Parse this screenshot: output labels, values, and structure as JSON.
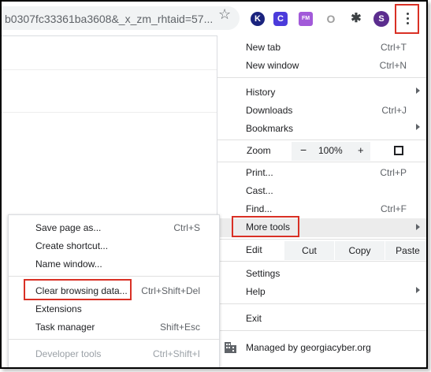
{
  "toolbar": {
    "url_text": "b0307fc33361ba3608&_x_zm_rhtaid=57...",
    "star_icon": "☆",
    "extensions": [
      {
        "name": "k-extension-icon",
        "letter": "K",
        "color": "#1a237e"
      },
      {
        "name": "c-extension-icon",
        "letter": "C",
        "color": "#4b3bdb"
      },
      {
        "name": "puzzle-purple-extension-icon",
        "letter": "FM",
        "color": "#a25ad9"
      },
      {
        "name": "office-extension-icon",
        "letter": "O",
        "color": "#9e9e9e"
      },
      {
        "name": "extensions-puzzle-icon",
        "letter": "✱",
        "color": "#3c4043"
      },
      {
        "name": "profile-avatar",
        "letter": "S",
        "color": "#5b2d8e"
      }
    ]
  },
  "menu": {
    "new_tab": {
      "label": "New tab",
      "shortcut": "Ctrl+T"
    },
    "new_window": {
      "label": "New window",
      "shortcut": "Ctrl+N"
    },
    "history": {
      "label": "History"
    },
    "downloads": {
      "label": "Downloads",
      "shortcut": "Ctrl+J"
    },
    "bookmarks": {
      "label": "Bookmarks"
    },
    "zoom": {
      "label": "Zoom",
      "minus": "−",
      "value": "100%",
      "plus": "+"
    },
    "print": {
      "label": "Print...",
      "shortcut": "Ctrl+P"
    },
    "cast": {
      "label": "Cast..."
    },
    "find": {
      "label": "Find...",
      "shortcut": "Ctrl+F"
    },
    "more_tools": {
      "label": "More tools"
    },
    "edit": {
      "label": "Edit",
      "cut": "Cut",
      "copy": "Copy",
      "paste": "Paste"
    },
    "settings": {
      "label": "Settings"
    },
    "help": {
      "label": "Help"
    },
    "exit": {
      "label": "Exit"
    },
    "managed": {
      "label": "Managed by georgiacyber.org"
    }
  },
  "submenu": {
    "save_page": {
      "label": "Save page as...",
      "shortcut": "Ctrl+S"
    },
    "create_shortcut": {
      "label": "Create shortcut..."
    },
    "name_window": {
      "label": "Name window..."
    },
    "clear_data": {
      "label": "Clear browsing data...",
      "shortcut": "Ctrl+Shift+Del"
    },
    "extensions": {
      "label": "Extensions"
    },
    "task_manager": {
      "label": "Task manager",
      "shortcut": "Shift+Esc"
    },
    "developer_tools": {
      "label": "Developer tools",
      "shortcut": "Ctrl+Shift+I"
    }
  },
  "colors": {
    "highlight_box": "#d93025",
    "menu_hover": "#ececec"
  }
}
